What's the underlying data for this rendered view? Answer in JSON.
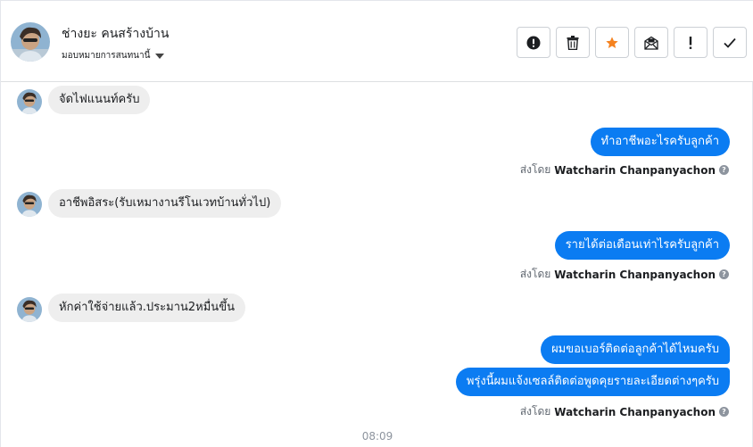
{
  "header": {
    "contact_name": "ช่างยะ คนสร้างบ้าน",
    "assign_label": "มอบหมายการสนทนานี้"
  },
  "actions": [
    {
      "name": "report-spam-button",
      "icon": "alert-circle-icon",
      "color": "#1c1e21"
    },
    {
      "name": "delete-button",
      "icon": "trash-icon",
      "color": "#1c1e21"
    },
    {
      "name": "star-button",
      "icon": "star-icon",
      "color": "#f5821f"
    },
    {
      "name": "mark-unread-button",
      "icon": "envelope-icon",
      "color": "#1c1e21"
    },
    {
      "name": "follow-up-button",
      "icon": "exclamation-icon",
      "color": "#1c1e21"
    },
    {
      "name": "mark-done-button",
      "icon": "check-icon",
      "color": "#1c1e21"
    }
  ],
  "messages": {
    "m1": "จัดไฟแนนท์ครับ",
    "m2": "ทำอาชีพอะไรครับลูกค้า",
    "m3": "อาชีพอิสระ(รับเหมางานรีโนเวทบ้านทั่วไป)",
    "m4": "รายได้ต่อเดือนเท่าไรครับลูกค้า",
    "m5": "หักค่าใช้จ่ายแล้ว.ประมาน2หมื่นขึ้น",
    "m6": "ผมขอเบอร์ติดต่อลูกค้าได้ไหมครับ",
    "m7": "พรุ่งนี้ผมแจ้งเซลล์ติดต่อพูดคุยรายละเอียดต่างๆครับ"
  },
  "sent_by": {
    "prefix": "ส่งโดย",
    "agent": "Watcharin Chanpanyachon"
  },
  "timestamp": "08:09",
  "colors": {
    "outgoing_bubble": "#0b7cf2",
    "incoming_bubble": "#eeeeee",
    "star": "#f5821f"
  }
}
